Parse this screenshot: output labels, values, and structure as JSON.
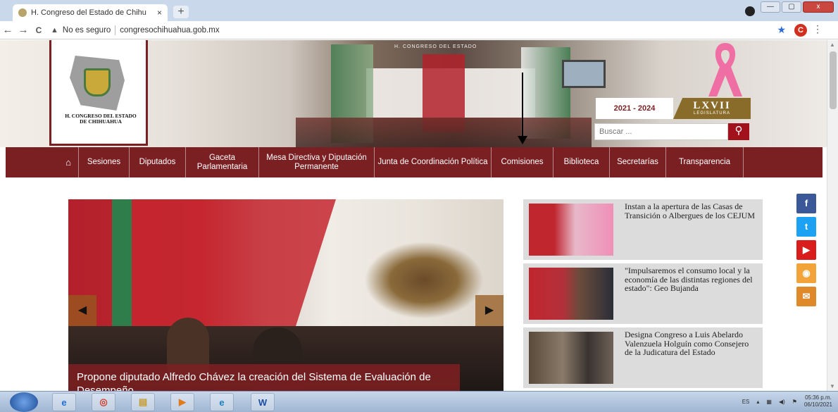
{
  "browser": {
    "tab_title": "H. Congreso del Estado de Chihu",
    "tab_close": "×",
    "new_tab": "+",
    "insecure_label": "No es seguro",
    "url": "congresochihuahua.gob.mx",
    "back": "←",
    "forward": "→",
    "reload": "C",
    "star": "★",
    "profile_initial": "C",
    "menu_dots": "⋮",
    "window_controls": {
      "minimize": "—",
      "maximize": "▢",
      "close": "x"
    }
  },
  "header": {
    "logo_text_line1": "H. CONGRESO DEL ESTADO",
    "logo_text_line2": "DE CHIHUAHUA",
    "banner_inscription": "H. CONGRESO DEL ESTADO",
    "years": "2021 - 2024",
    "legislature": "LXVII",
    "legislature_sub": "LEGISLATURA",
    "search_placeholder": "Buscar ...",
    "search_button": "⚲"
  },
  "menu": {
    "home_icon": "⌂",
    "items": [
      "Sesiones",
      "Diputados",
      "Gaceta Parlamentaria",
      "Mesa Directiva y Diputación Permanente",
      "Junta de Coordinación Política",
      "Comisiones",
      "Biblioteca",
      "Secretarías",
      "Transparencia"
    ]
  },
  "slider": {
    "prev": "◀",
    "next": "▶",
    "caption": "Propone diputado Alfredo Chávez la creación del Sistema de Evaluación de Desempeño"
  },
  "news": [
    {
      "text": "Instan a la apertura de las Casas de Transición o Albergues de los CEJUM"
    },
    {
      "text": "\"Impulsaremos el consumo local y la economía de las distintas regiones del estado\": Geo Bujanda"
    },
    {
      "text": "Designa Congreso a Luis Abelardo Valenzuela Holguín como Consejero de la Judicatura del Estado"
    }
  ],
  "social": {
    "facebook": "f",
    "twitter": "t",
    "youtube": "▶",
    "rss": "◉",
    "email": "✉"
  },
  "taskbar": {
    "apps": [
      "e",
      "◎",
      "▤",
      "▶",
      "e",
      "W"
    ],
    "lang": "ES",
    "time": "05:36 p.m.",
    "date": "06/10/2021"
  },
  "colors": {
    "brand": "#7a1f22",
    "search_button": "#a2121c",
    "facebook": "#3b5998",
    "twitter": "#1da1f2",
    "youtube": "#d91c1c",
    "rss": "#f2a33a",
    "email": "#e0892a"
  }
}
